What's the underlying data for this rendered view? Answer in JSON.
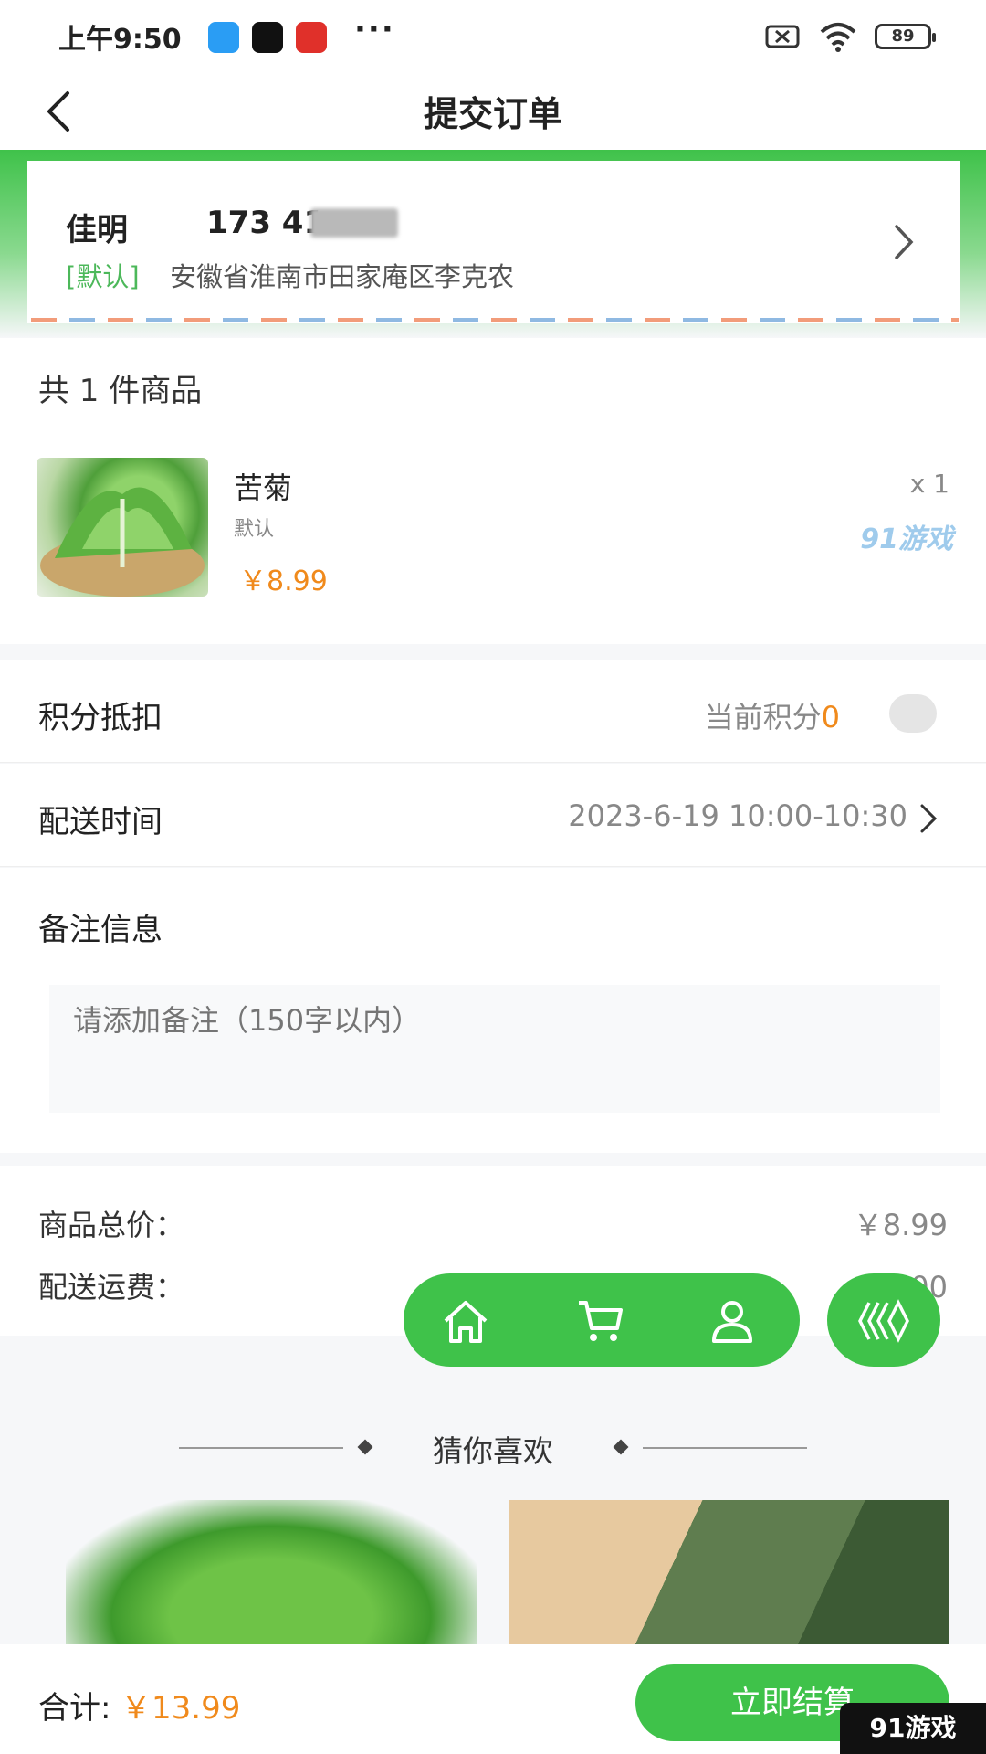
{
  "status_bar": {
    "time": "上午9:50",
    "battery": "89",
    "more": "···",
    "app_icons": [
      "chat-icon",
      "tiktok-icon",
      "kandian-icon"
    ]
  },
  "nav": {
    "title": "提交订单"
  },
  "address": {
    "name": "佳明",
    "phone": "173     41",
    "tag": "[默认]",
    "detail": "安徽省淮南市田家庵区李克农"
  },
  "goods": {
    "count_label": "共 1 件商品",
    "items": [
      {
        "name": "苦菊",
        "spec": "默认",
        "price": "￥8.99",
        "qty": "x 1"
      }
    ]
  },
  "watermark": "91游戏",
  "points": {
    "label": "积分抵扣",
    "current_label": "当前积分",
    "value": "0",
    "enabled": false
  },
  "delivery": {
    "label": "配送时间",
    "value": "2023-6-19 10:00-10:30"
  },
  "remark": {
    "label": "备注信息",
    "placeholder": "请添加备注（150字以内）"
  },
  "summary": {
    "goods_total_label": "商品总价：",
    "goods_total": "￥8.99",
    "shipping_label": "配送运费：",
    "shipping": "￥5.00"
  },
  "recommend": {
    "title": "猜你喜欢"
  },
  "bottom": {
    "total_label": "合计:",
    "total": "￥13.99",
    "checkout": "立即结算"
  },
  "corner_logo": "91游戏",
  "colors": {
    "accent": "#3fc24a",
    "price": "#f08a1c",
    "tag": "#4cb85a"
  }
}
